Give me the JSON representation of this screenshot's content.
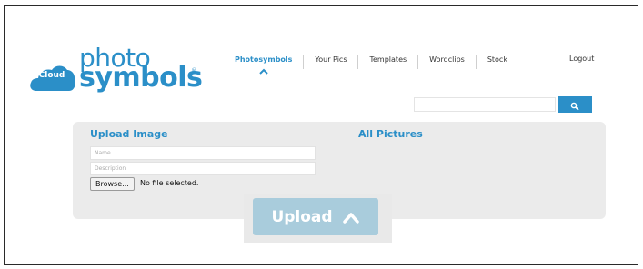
{
  "logo": {
    "cloud_word": "Cloud",
    "photo": "photo",
    "symbols": "symbols",
    "registered": "®",
    "brand_color": "#2b8fc8"
  },
  "nav": {
    "items": [
      {
        "label": "Photosymbols",
        "active": true
      },
      {
        "label": "Your Pics"
      },
      {
        "label": "Templates"
      },
      {
        "label": "Wordclips"
      },
      {
        "label": "Stock"
      }
    ],
    "logout": "Logout"
  },
  "search": {
    "value": "",
    "icon": "search-icon"
  },
  "upload": {
    "title": "Upload Image",
    "all_pictures": "All Pictures",
    "name_placeholder": "Name",
    "description_placeholder": "Description",
    "browse_label": "Browse...",
    "file_status": "No file selected.",
    "button_label": "Upload"
  }
}
